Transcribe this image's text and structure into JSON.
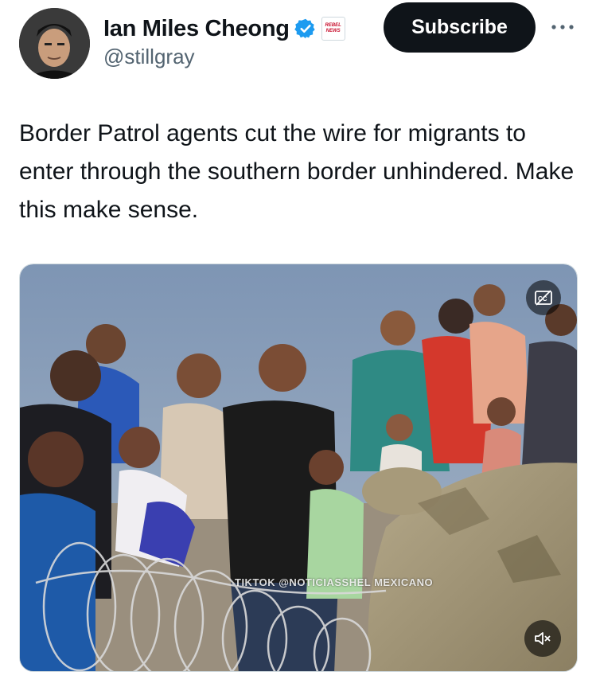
{
  "author": {
    "display_name": "Ian Miles Cheong",
    "handle": "@stillgray",
    "verified": true,
    "affiliate_badge_line1": "REBEL",
    "affiliate_badge_line2": "NEWS",
    "avatar_icon": "avatar-photo"
  },
  "actions": {
    "subscribe_label": "Subscribe",
    "more_icon": "more-horizontal-icon"
  },
  "tweet": {
    "text": "Border Patrol agents cut the wire for migrants to enter through the southern border unhindered. Make this make sense."
  },
  "media": {
    "type": "video",
    "watermark": "TIKTOK @NOTICIASSHEL MEXICANO",
    "captions_icon": "closed-captions-off-icon",
    "mute_icon": "volume-muted-icon"
  },
  "colors": {
    "verified_blue": "#1d9bf0",
    "text_primary": "#0f1419",
    "text_secondary": "#536471",
    "button_dark": "#0f1419"
  }
}
